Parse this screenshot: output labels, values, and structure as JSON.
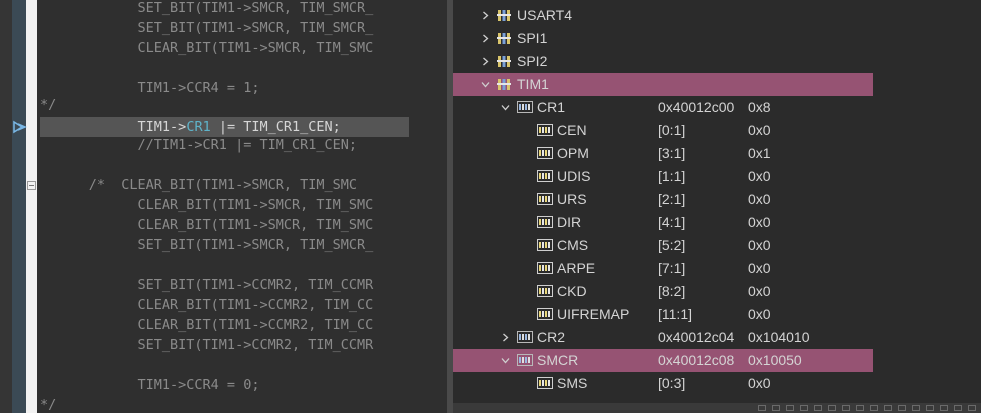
{
  "editor": {
    "lines": [
      {
        "indent": "            ",
        "text": "SET_BIT(TIM1->SMCR, TIM_SMCR_"
      },
      {
        "indent": "            ",
        "text": "SET_BIT(TIM1->SMCR, TIM_SMCR_"
      },
      {
        "indent": "            ",
        "text": "CLEAR_BIT(TIM1->SMCR, TIM_SMC"
      },
      {
        "indent": "",
        "text": ""
      },
      {
        "indent": "            ",
        "text": "TIM1->CCR4 = 1;"
      },
      {
        "indent": "",
        "text": "*/"
      },
      {
        "indent": "",
        "text": ""
      },
      {
        "indent": "            ",
        "text": "//TIM1->CR1 |= TIM_CR1_CEN;"
      },
      {
        "indent": "",
        "text": ""
      },
      {
        "indent": "      ",
        "text": "/*  CLEAR_BIT(TIM1->SMCR, TIM_SMC"
      },
      {
        "indent": "            ",
        "text": "CLEAR_BIT(TIM1->SMCR, TIM_SMC"
      },
      {
        "indent": "            ",
        "text": "CLEAR_BIT(TIM1->SMCR, TIM_SMC"
      },
      {
        "indent": "            ",
        "text": "SET_BIT(TIM1->SMCR, TIM_SMCR_"
      },
      {
        "indent": "",
        "text": ""
      },
      {
        "indent": "            ",
        "text": "SET_BIT(TIM1->CCMR2, TIM_CCMR"
      },
      {
        "indent": "            ",
        "text": "CLEAR_BIT(TIM1->CCMR2, TIM_CC"
      },
      {
        "indent": "            ",
        "text": "CLEAR_BIT(TIM1->CCMR2, TIM_CC"
      },
      {
        "indent": "            ",
        "text": "SET_BIT(TIM1->CCMR2, TIM_CCMR"
      },
      {
        "indent": "",
        "text": ""
      },
      {
        "indent": "            ",
        "text": "TIM1->CCR4 = 0;"
      },
      {
        "indent": "",
        "text": "*/"
      }
    ],
    "active_line": {
      "pre": "            TIM1->",
      "kw": "CR1",
      "post": " |= TIM_CR1_CEN;"
    }
  },
  "registers": [
    {
      "name": "USART4",
      "addr": "",
      "val": "",
      "level": 0,
      "chevron": "right",
      "icon": "peripheral-icon",
      "selected": false
    },
    {
      "name": "SPI1",
      "addr": "",
      "val": "",
      "level": 0,
      "chevron": "right",
      "icon": "peripheral-icon",
      "selected": false
    },
    {
      "name": "SPI2",
      "addr": "",
      "val": "",
      "level": 0,
      "chevron": "right",
      "icon": "peripheral-icon",
      "selected": false
    },
    {
      "name": "TIM1",
      "addr": "",
      "val": "",
      "level": 0,
      "chevron": "down",
      "icon": "peripheral-icon",
      "selected": true
    },
    {
      "name": "CR1",
      "addr": "0x40012c00",
      "val": "0x8",
      "level": 1,
      "chevron": "down",
      "icon": "register-icon",
      "selected": false
    },
    {
      "name": "CEN",
      "addr": "[0:1]",
      "val": "0x0",
      "level": 2,
      "chevron": "",
      "icon": "field-icon",
      "selected": false
    },
    {
      "name": "OPM",
      "addr": "[3:1]",
      "val": "0x1",
      "level": 2,
      "chevron": "",
      "icon": "field-icon",
      "selected": false
    },
    {
      "name": "UDIS",
      "addr": "[1:1]",
      "val": "0x0",
      "level": 2,
      "chevron": "",
      "icon": "field-icon",
      "selected": false
    },
    {
      "name": "URS",
      "addr": "[2:1]",
      "val": "0x0",
      "level": 2,
      "chevron": "",
      "icon": "field-icon",
      "selected": false
    },
    {
      "name": "DIR",
      "addr": "[4:1]",
      "val": "0x0",
      "level": 2,
      "chevron": "",
      "icon": "field-icon",
      "selected": false
    },
    {
      "name": "CMS",
      "addr": "[5:2]",
      "val": "0x0",
      "level": 2,
      "chevron": "",
      "icon": "field-icon",
      "selected": false
    },
    {
      "name": "ARPE",
      "addr": "[7:1]",
      "val": "0x0",
      "level": 2,
      "chevron": "",
      "icon": "field-icon",
      "selected": false
    },
    {
      "name": "CKD",
      "addr": "[8:2]",
      "val": "0x0",
      "level": 2,
      "chevron": "",
      "icon": "field-icon",
      "selected": false
    },
    {
      "name": "UIFREMAP",
      "addr": "[11:1]",
      "val": "0x0",
      "level": 2,
      "chevron": "",
      "icon": "field-icon",
      "selected": false
    },
    {
      "name": "CR2",
      "addr": "0x40012c04",
      "val": "0x104010",
      "level": 1,
      "chevron": "right",
      "icon": "register-icon",
      "selected": false
    },
    {
      "name": "SMCR",
      "addr": "0x40012c08",
      "val": "0x10050",
      "level": 1,
      "chevron": "down",
      "icon": "register-icon",
      "selected": true
    },
    {
      "name": "SMS",
      "addr": "[0:3]",
      "val": "0x0",
      "level": 2,
      "chevron": "",
      "icon": "field-icon",
      "selected": false
    }
  ],
  "colors": {
    "selection": "#965373",
    "keyword": "#5fb3c9",
    "code_text": "#8a8a8a"
  }
}
